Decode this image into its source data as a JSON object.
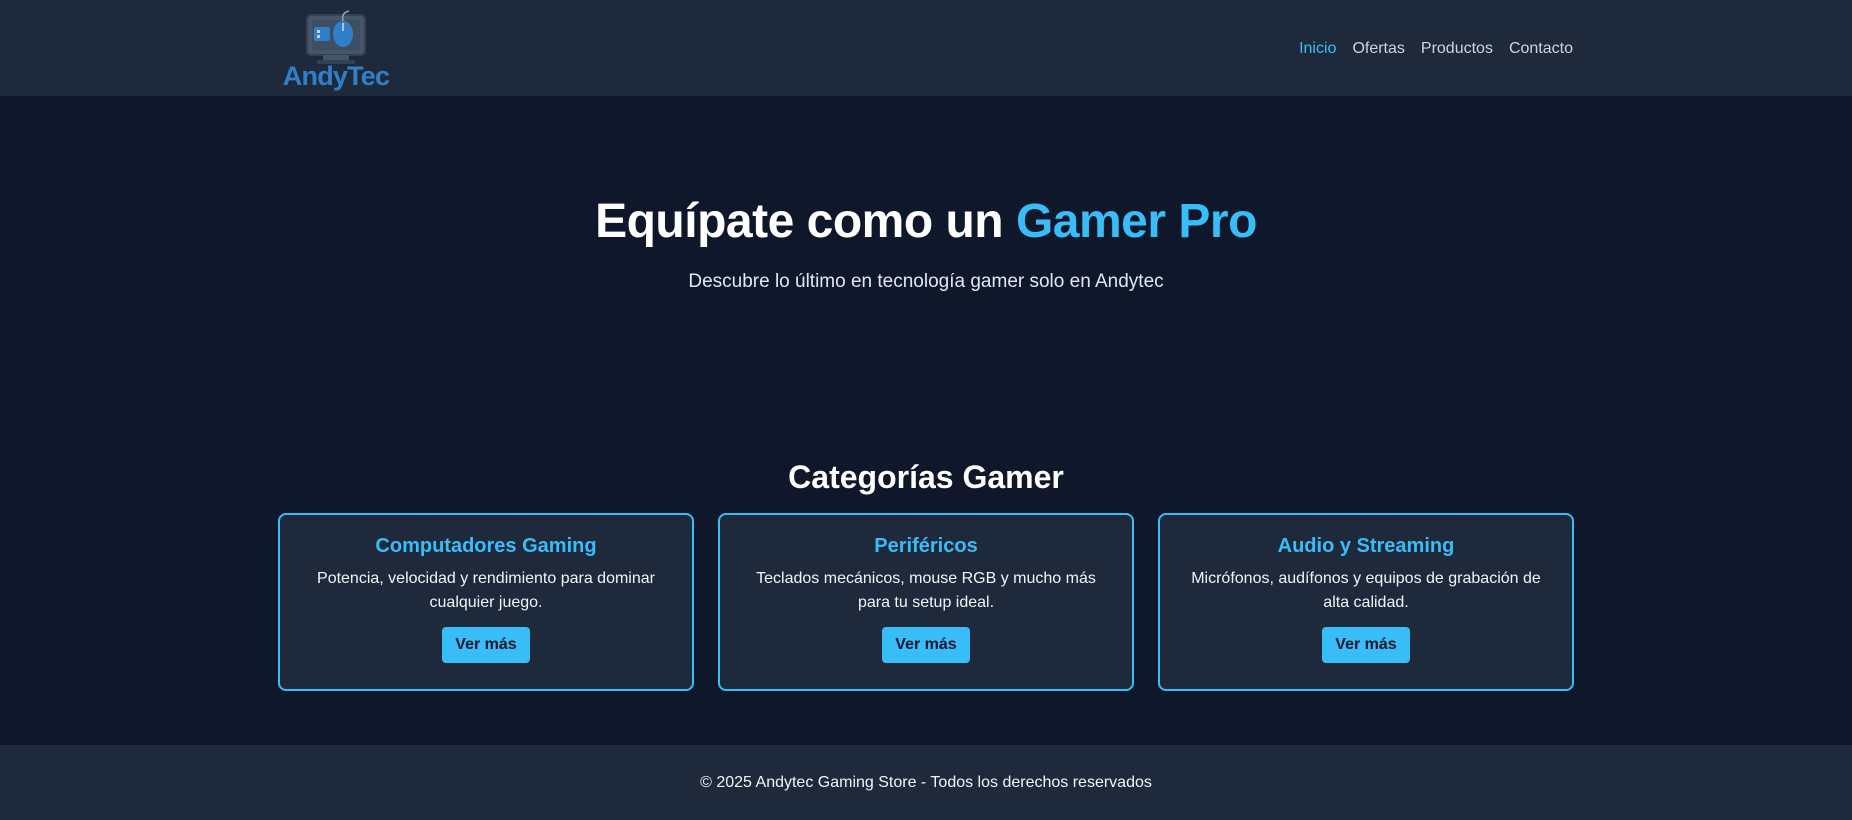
{
  "header": {
    "logo_text": "AndyTec",
    "nav": [
      {
        "label": "Inicio",
        "active": true
      },
      {
        "label": "Ofertas",
        "active": false
      },
      {
        "label": "Productos",
        "active": false
      },
      {
        "label": "Contacto",
        "active": false
      }
    ]
  },
  "hero": {
    "title_main": "Equípate como un",
    "title_accent": "Gamer Pro",
    "subtitle": "Descubre lo último en tecnología gamer solo en Andytec"
  },
  "categories": {
    "title": "Categorías Gamer",
    "cards": [
      {
        "title": "Computadores Gaming",
        "description": "Potencia, velocidad y rendimiento para dominar cualquier juego.",
        "button": "Ver más"
      },
      {
        "title": "Periféricos",
        "description": "Teclados mecánicos, mouse RGB y mucho más para tu setup ideal.",
        "button": "Ver más"
      },
      {
        "title": "Audio y Streaming",
        "description": "Micrófonos, audífonos y equipos de grabación de alta calidad.",
        "button": "Ver más"
      }
    ]
  },
  "footer": {
    "text": "© 2025 Andytec Gaming Store - Todos los derechos reservados"
  },
  "colors": {
    "accent": "#38bdf8",
    "background": "#0f172a",
    "surface": "#1e293b",
    "logo": "#2f80c8"
  },
  "icons": {
    "logo": "monitor-mouse-icon"
  }
}
